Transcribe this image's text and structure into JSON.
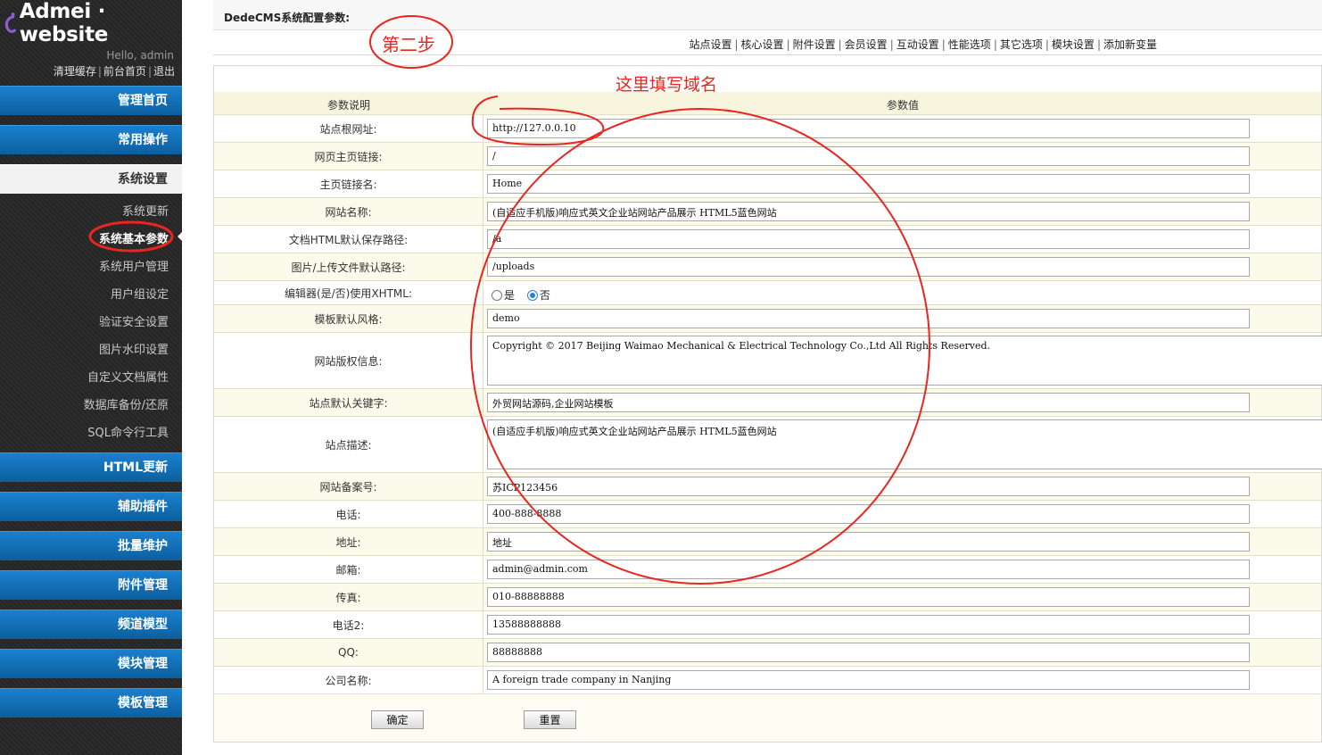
{
  "sidebar": {
    "logo_text": "Admei · website",
    "greeting": "Hello, admin",
    "top_links": [
      "清理缓存",
      "前台首页",
      "退出"
    ],
    "menu_heads": [
      {
        "label": "管理首页",
        "active": false
      },
      {
        "label": "常用操作",
        "active": false
      },
      {
        "label": "系统设置",
        "active": true
      },
      {
        "label": "HTML更新",
        "active": false
      },
      {
        "label": "辅助插件",
        "active": false
      },
      {
        "label": "批量维护",
        "active": false
      },
      {
        "label": "附件管理",
        "active": false
      },
      {
        "label": "频道模型",
        "active": false
      },
      {
        "label": "模块管理",
        "active": false
      },
      {
        "label": "模板管理",
        "active": false
      }
    ],
    "system_items": [
      "系统更新",
      "系统基本参数",
      "系统用户管理",
      "用户组设定",
      "验证安全设置",
      "图片水印设置",
      "自定义文档属性",
      "数据库备份/还原",
      "SQL命令行工具"
    ],
    "current_item": "系统基本参数"
  },
  "main": {
    "crumb": "DedeCMS系统配置参数:",
    "tabs": [
      "站点设置",
      "核心设置",
      "附件设置",
      "会员设置",
      "互动设置",
      "性能选项",
      "其它选项",
      "模块设置",
      "添加新变量"
    ],
    "table_header": {
      "label": "参数说明",
      "value": "参数值"
    },
    "rows": [
      {
        "label": "站点根网址:",
        "value": "http://127.0.0.10",
        "kind": "input"
      },
      {
        "label": "网页主页链接:",
        "value": "/",
        "kind": "input"
      },
      {
        "label": "主页链接名:",
        "value": "Home",
        "kind": "input"
      },
      {
        "label": "网站名称:",
        "value": "(自适应手机版)响应式英文企业站网站产品展示 HTML5蓝色网站",
        "kind": "input"
      },
      {
        "label": "文档HTML默认保存路径:",
        "value": "/a",
        "kind": "input"
      },
      {
        "label": "图片/上传文件默认路径:",
        "value": "/uploads",
        "kind": "input"
      },
      {
        "label": "编辑器(是/否)使用XHTML:",
        "kind": "radio",
        "options": [
          "是",
          "否"
        ],
        "selected": "否"
      },
      {
        "label": "模板默认风格:",
        "value": "demo",
        "kind": "input"
      },
      {
        "label": "网站版权信息:",
        "value": "Copyright © 2017 Beijing Waimao Mechanical & Electrical Technology Co.,Ltd All Rights Reserved.",
        "kind": "textarea"
      },
      {
        "label": "站点默认关键字:",
        "value": "外贸网站源码,企业网站模板",
        "kind": "input"
      },
      {
        "label": "站点描述:",
        "value": "(自适应手机版)响应式英文企业站网站产品展示 HTML5蓝色网站",
        "kind": "textarea"
      },
      {
        "label": "网站备案号:",
        "value": "苏ICP123456",
        "kind": "input"
      },
      {
        "label": "电话:",
        "value": "400-888-8888",
        "kind": "input"
      },
      {
        "label": "地址:",
        "value": "地址",
        "kind": "input"
      },
      {
        "label": "邮箱:",
        "value": "admin@admin.com",
        "kind": "input"
      },
      {
        "label": "传真:",
        "value": "010-88888888",
        "kind": "input"
      },
      {
        "label": "电话2:",
        "value": "13588888888",
        "kind": "input"
      },
      {
        "label": "QQ:",
        "value": "88888888",
        "kind": "input"
      },
      {
        "label": "公司名称:",
        "value": "A foreign trade company in Nanjing",
        "kind": "input"
      }
    ],
    "buttons": {
      "confirm": "确定",
      "reset": "重置"
    }
  },
  "annotations": {
    "step_label": "第二步",
    "domain_hint": "这里填写域名",
    "color": "#e8261f"
  }
}
